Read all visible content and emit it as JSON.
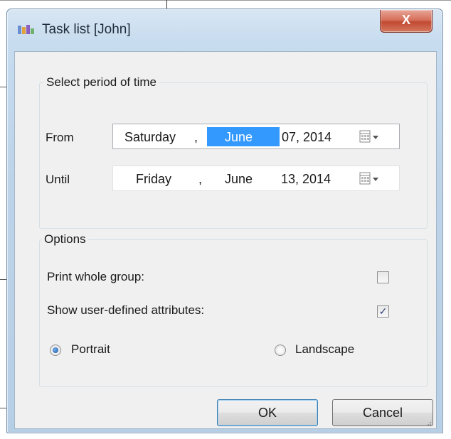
{
  "window": {
    "title": "Task list [John]",
    "close_label": "X",
    "icon": "task-list-app-icon"
  },
  "period_group": {
    "title": "Select period of time",
    "from": {
      "label": "From",
      "weekday": "Saturday",
      "sep": ",",
      "month": "June",
      "day_year": "07, 2014",
      "month_selected": true
    },
    "until": {
      "label": "Until",
      "weekday": "Friday",
      "sep": ",",
      "month": "June",
      "day_year": "13, 2014"
    },
    "calendar_icon": "calendar-dropdown-icon"
  },
  "options_group": {
    "title": "Options",
    "print_whole_group": {
      "label": "Print whole group:",
      "checked": false
    },
    "show_attributes": {
      "label": "Show user-defined attributes:",
      "checked": true,
      "check_glyph": "✓"
    },
    "orientation": {
      "portrait": {
        "label": "Portrait",
        "selected": true
      },
      "landscape": {
        "label": "Landscape",
        "selected": false
      }
    }
  },
  "buttons": {
    "ok": "OK",
    "cancel": "Cancel"
  },
  "colors": {
    "selection": "#3399ff",
    "close_button": "#c24a32",
    "window_frame": "#bdd3e8"
  }
}
